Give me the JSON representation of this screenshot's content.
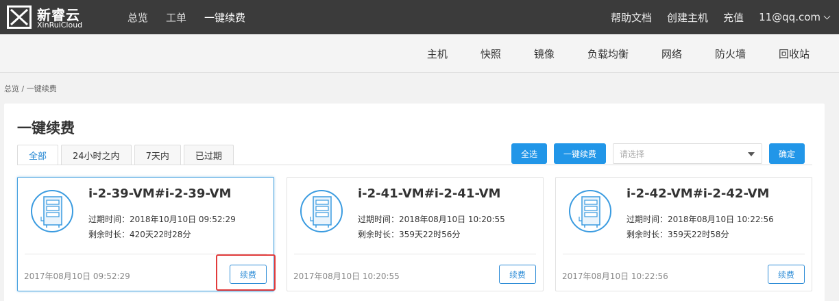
{
  "brand": {
    "name_cn": "新睿云",
    "name_en": "XinRuiCloud"
  },
  "topnav": {
    "left": [
      "总览",
      "工单",
      "一键续费"
    ],
    "active_index": 2,
    "right": {
      "help": "帮助文档",
      "create": "创建主机",
      "recharge": "充值",
      "user": "11@qq.com"
    }
  },
  "subnav": [
    "主机",
    "快照",
    "镜像",
    "负载均衡",
    "网络",
    "防火墙",
    "回收站"
  ],
  "breadcrumb": "总览 / 一键续费",
  "page_title": "一键续费",
  "tabs": [
    "全部",
    "24小时之内",
    "7天内",
    "已过期"
  ],
  "active_tab": 0,
  "toolbar": {
    "select_all": "全选",
    "renew_all": "一键续费",
    "select_placeholder": "请选择",
    "confirm": "确定"
  },
  "cards": [
    {
      "name": "i-2-39-VM#i-2-39-VM",
      "expire": "过期时间：2018年10月10日 09:52:29",
      "remain": "剩余时长：420天22时28分",
      "created": "2017年08月10日 09:52:29",
      "renew": "续费",
      "selected": true
    },
    {
      "name": "i-2-41-VM#i-2-41-VM",
      "expire": "过期时间：2018年08月10日 10:20:55",
      "remain": "剩余时长：359天22时56分",
      "created": "2017年08月10日 10:20:55",
      "renew": "续费",
      "selected": false
    },
    {
      "name": "i-2-42-VM#i-2-42-VM",
      "expire": "过期时间：2018年08月10日 10:22:56",
      "remain": "剩余时长：359天22时58分",
      "created": "2017年08月10日 10:22:56",
      "renew": "续费",
      "selected": false
    }
  ],
  "colors": {
    "accent": "#2196e8",
    "topbar": "#3b3b3b",
    "highlight": "#e23b3b"
  },
  "icons": [
    "logo-mark-icon",
    "chevron-down-icon",
    "caret-down-icon",
    "server-icon"
  ]
}
